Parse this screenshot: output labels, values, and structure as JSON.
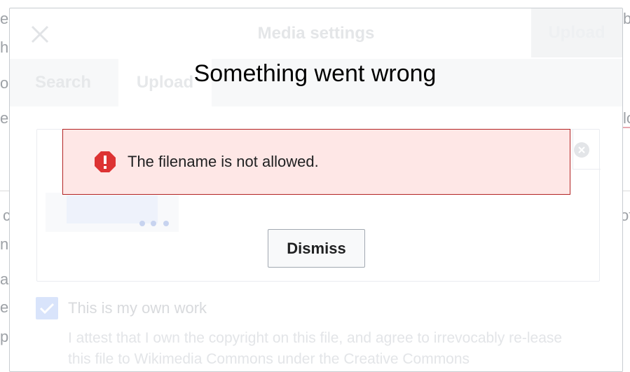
{
  "background": {
    "left_fragments": [
      "e",
      "he",
      "or",
      "e",
      "c",
      "n,",
      "ar",
      "ec",
      "p"
    ],
    "right_fragments": [
      "be",
      "lo",
      "of"
    ]
  },
  "dialog": {
    "title": "Media settings",
    "primary_action": "Upload",
    "close_icon": "close-icon",
    "tabs": [
      {
        "label": "Search",
        "selected": false
      },
      {
        "label": "Upload",
        "selected": true
      }
    ],
    "own_work_checkbox": {
      "label": "This is my own work",
      "checked": true,
      "description": "I attest that I own the copyright on this file, and agree to irrevocably re-lease this file to Wikimedia Commons under the Creative Commons"
    }
  },
  "error": {
    "title": "Something went wrong",
    "message": "The filename is not allowed.",
    "icon": "error-icon",
    "dismiss_label": "Dismiss"
  },
  "colors": {
    "error_bg": "#fee7e6",
    "error_border": "#b32424",
    "error_icon": "#d33"
  }
}
